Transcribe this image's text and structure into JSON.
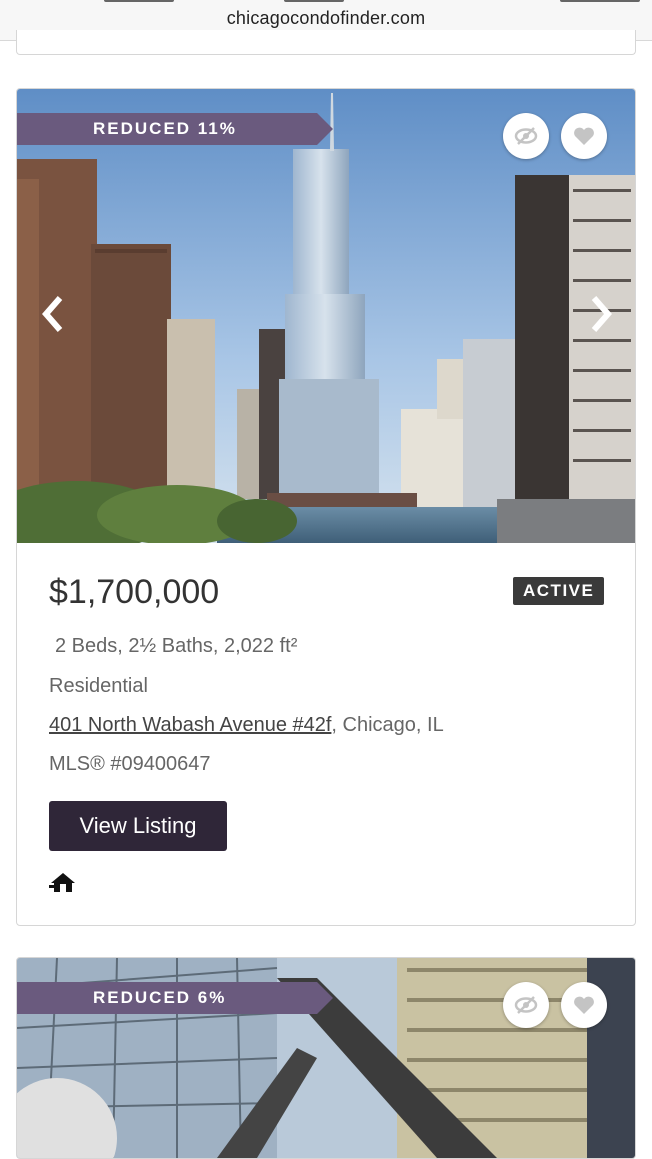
{
  "browser": {
    "url": "chicagocondofinder.com"
  },
  "listings": [
    {
      "badge": "REDUCED 11%",
      "price": "$1,700,000",
      "status": "ACTIVE",
      "details": "2 Beds, 2½ Baths, 2,022 ft²",
      "property_type": "Residential",
      "address_link": "401 North Wabash Avenue #42f",
      "address_rest": ", Chicago, IL",
      "mls": "MLS® #09400647",
      "view_button": "View Listing"
    },
    {
      "badge": "REDUCED 6%"
    }
  ],
  "icons": {
    "hide": "eye-slash-icon",
    "favorite": "heart-icon",
    "prev": "chevron-left-icon",
    "next": "chevron-right-icon",
    "broker": "broker-reciprocity-icon"
  },
  "colors": {
    "ribbon": "#6a5a7e",
    "button": "#2f2638",
    "status_badge": "#3a3a3a"
  }
}
